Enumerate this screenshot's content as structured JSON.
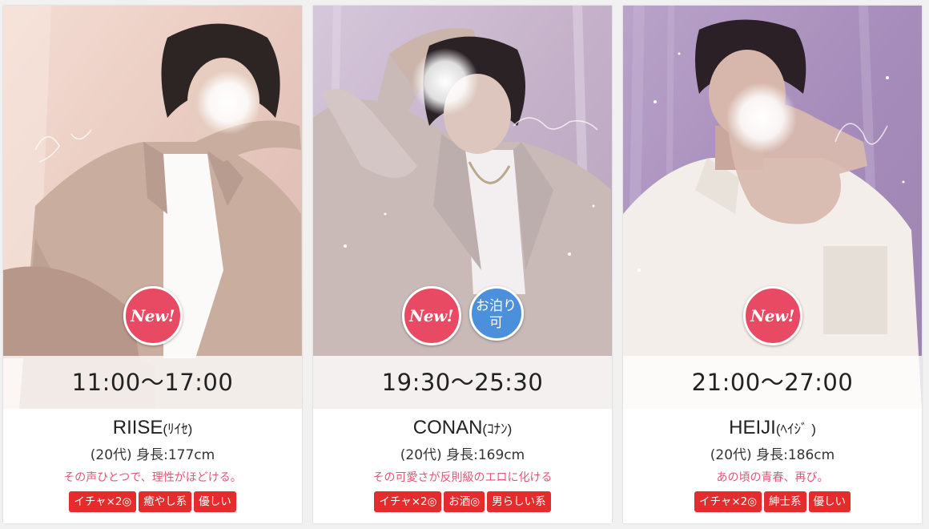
{
  "casts": [
    {
      "time": "11:00〜17:00",
      "name": "RIISE",
      "kana": "(ﾘｲｾ)",
      "age": "(20代)",
      "height": "身長:177cm",
      "catch": "その声ひとつで、理性がほどける。",
      "badges": [
        "New!"
      ],
      "tags": [
        "イチャ×2◎",
        "癒やし系",
        "優しい"
      ]
    },
    {
      "time": "19:30〜25:30",
      "name": "CONAN",
      "kana": "(ｺﾅﾝ)",
      "age": "(20代)",
      "height": "身長:169cm",
      "catch": "その可愛さが反則級のエロに化ける",
      "badges": [
        "New!",
        "お泊り可"
      ],
      "stay_badge_lines": [
        "お泊り",
        "可"
      ],
      "tags": [
        "イチャ×2◎",
        "お酒◎",
        "男らしい系"
      ]
    },
    {
      "time": "21:00〜27:00",
      "name": "HEIJI",
      "kana": "(ﾍｲｼﾞ )",
      "age": "(20代)",
      "height": "身長:186cm",
      "catch": "あの頃の青春、再び。",
      "badges": [
        "New!"
      ],
      "tags": [
        "イチャ×2◎",
        "紳士系",
        "優しい"
      ]
    }
  ],
  "colors": {
    "badge_new": "#e94a63",
    "badge_stay": "#4c8fdb",
    "tag_bg": "#e52c2c",
    "catch_text": "#e05774"
  }
}
